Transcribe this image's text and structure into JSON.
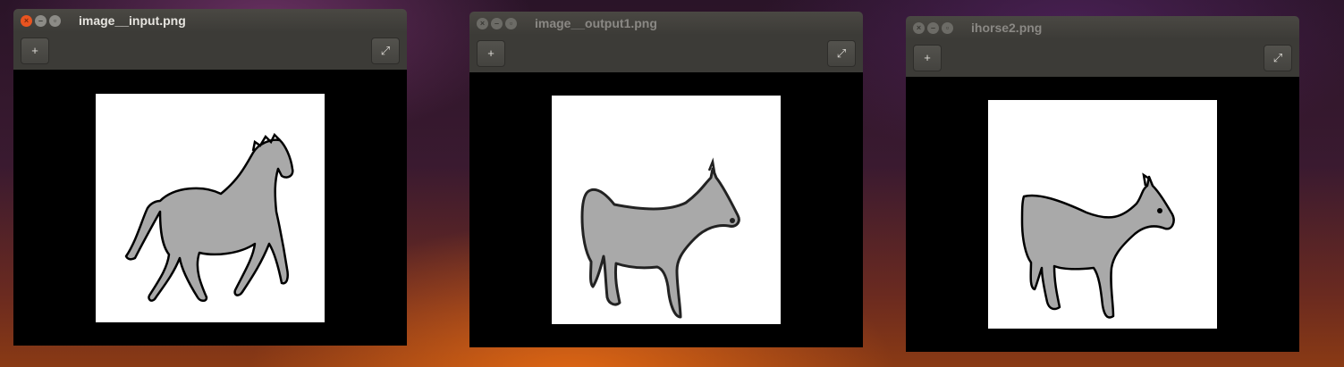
{
  "windows": [
    {
      "title": "image__input.png",
      "active": true
    },
    {
      "title": "image__output1.png",
      "active": false
    },
    {
      "title": "ihorse2.png",
      "active": false
    }
  ],
  "icons": {
    "close": "×",
    "minimize": "–",
    "maximize": "▫",
    "add": "+",
    "fullscreen": "⤢"
  }
}
